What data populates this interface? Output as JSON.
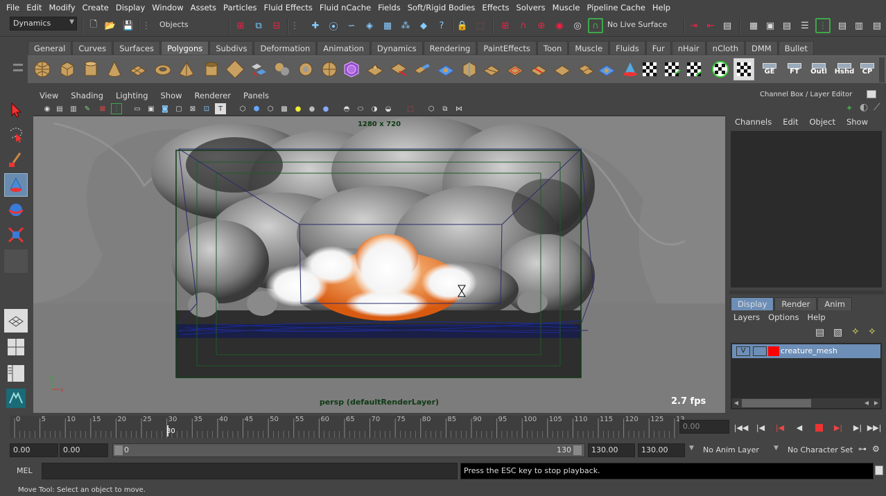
{
  "menubar": [
    "File",
    "Edit",
    "Modify",
    "Create",
    "Display",
    "Window",
    "Assets",
    "Particles",
    "Fluid Effects",
    "Fluid nCache",
    "Fields",
    "Soft/Rigid Bodies",
    "Effects",
    "Solvers",
    "Muscle",
    "Pipeline Cache",
    "Help"
  ],
  "status": {
    "menuset": "Dynamics",
    "selection_mode": "Objects",
    "live_surface": "No Live Surface"
  },
  "shelf_tabs": [
    "General",
    "Curves",
    "Surfaces",
    "Polygons",
    "Subdivs",
    "Deformation",
    "Animation",
    "Dynamics",
    "Rendering",
    "PaintEffects",
    "Toon",
    "Muscle",
    "Fluids",
    "Fur",
    "nHair",
    "nCloth",
    "DMM",
    "Bullet"
  ],
  "shelf_active": "Polygons",
  "shelf_text_buttons": [
    "GE",
    "FT",
    "Outl",
    "Hshd",
    "CP"
  ],
  "panel_menu": [
    "View",
    "Shading",
    "Lighting",
    "Show",
    "Renderer",
    "Panels"
  ],
  "viewport": {
    "resolution": "1280 x 720",
    "camera_label": "persp (defaultRenderLayer)",
    "fps": "2.7 fps"
  },
  "channel_box": {
    "title": "Channel Box / Layer Editor",
    "menu": [
      "Channels",
      "Edit",
      "Object",
      "Show"
    ],
    "layer_tabs": [
      "Display",
      "Render",
      "Anim"
    ],
    "layer_menu": [
      "Layers",
      "Options",
      "Help"
    ],
    "layer": {
      "visibility": "V",
      "name": "creature_mesh",
      "color": "#ff0000"
    }
  },
  "timeline": {
    "ticks": [
      "0",
      "5",
      "10",
      "15",
      "20",
      "25",
      "30",
      "35",
      "40",
      "45",
      "50",
      "55",
      "60",
      "65",
      "70",
      "75",
      "80",
      "85",
      "90",
      "95",
      "100",
      "105",
      "110",
      "115",
      "120",
      "125",
      "13"
    ],
    "current_frame": "30",
    "current_field": "0.00"
  },
  "range": {
    "start": "0.00",
    "start_inner": "0.00",
    "slider_start": "0",
    "slider_end": "130",
    "end_inner": "130.00",
    "end": "130.00",
    "anim_layer": "No Anim Layer",
    "character_set": "No Character Set"
  },
  "cmdline": {
    "label": "MEL",
    "input": "",
    "result": "Press the ESC key to stop playback."
  },
  "helpline": "Move Tool: Select an object to move.",
  "colors": {
    "accent_green": "#3fa84a",
    "panel": "#444444",
    "layer_selected": "#6d8fb7"
  }
}
